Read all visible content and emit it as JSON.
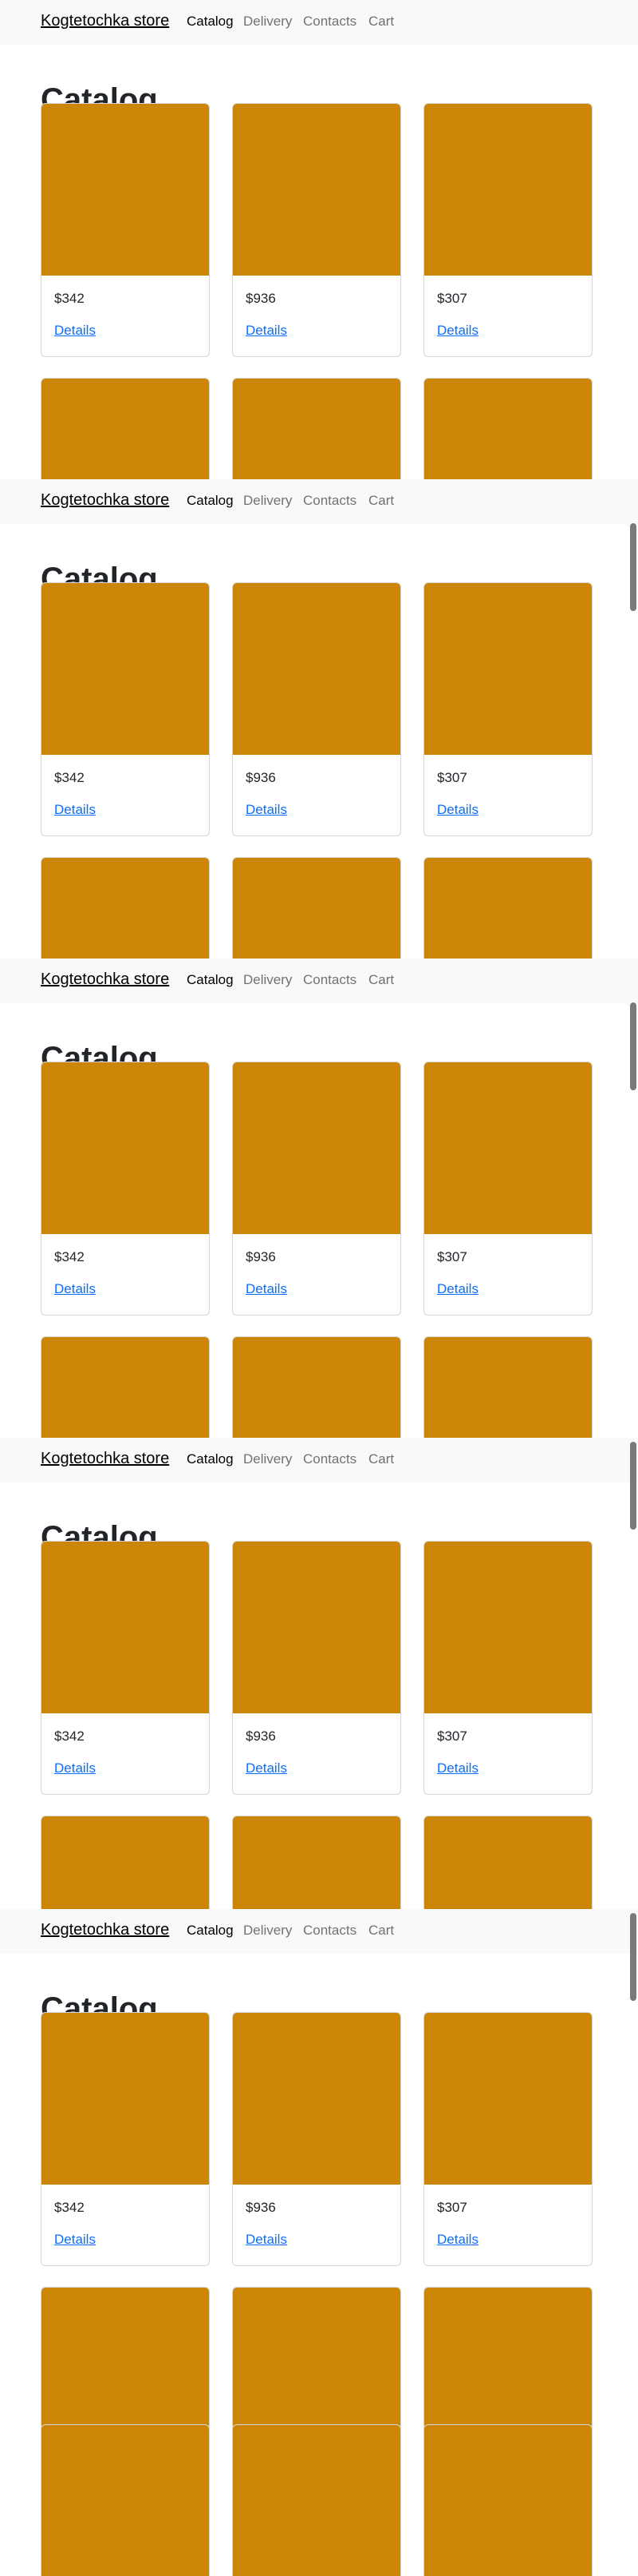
{
  "navbar": {
    "brand": "Kogtetochka store",
    "links": [
      {
        "label": "Catalog",
        "active": true
      },
      {
        "label": "Delivery",
        "active": false
      },
      {
        "label": "Contacts",
        "active": false
      },
      {
        "label": "Cart",
        "active": false
      }
    ]
  },
  "catalog": {
    "title": "Catalog",
    "products": [
      {
        "price": "$342",
        "details_label": "Details"
      },
      {
        "price": "$936",
        "details_label": "Details"
      },
      {
        "price": "$307",
        "details_label": "Details"
      }
    ]
  },
  "colors": {
    "product_image": "#cc8504",
    "navbar_bg": "#f8f9fa",
    "link": "#0d6efd"
  }
}
